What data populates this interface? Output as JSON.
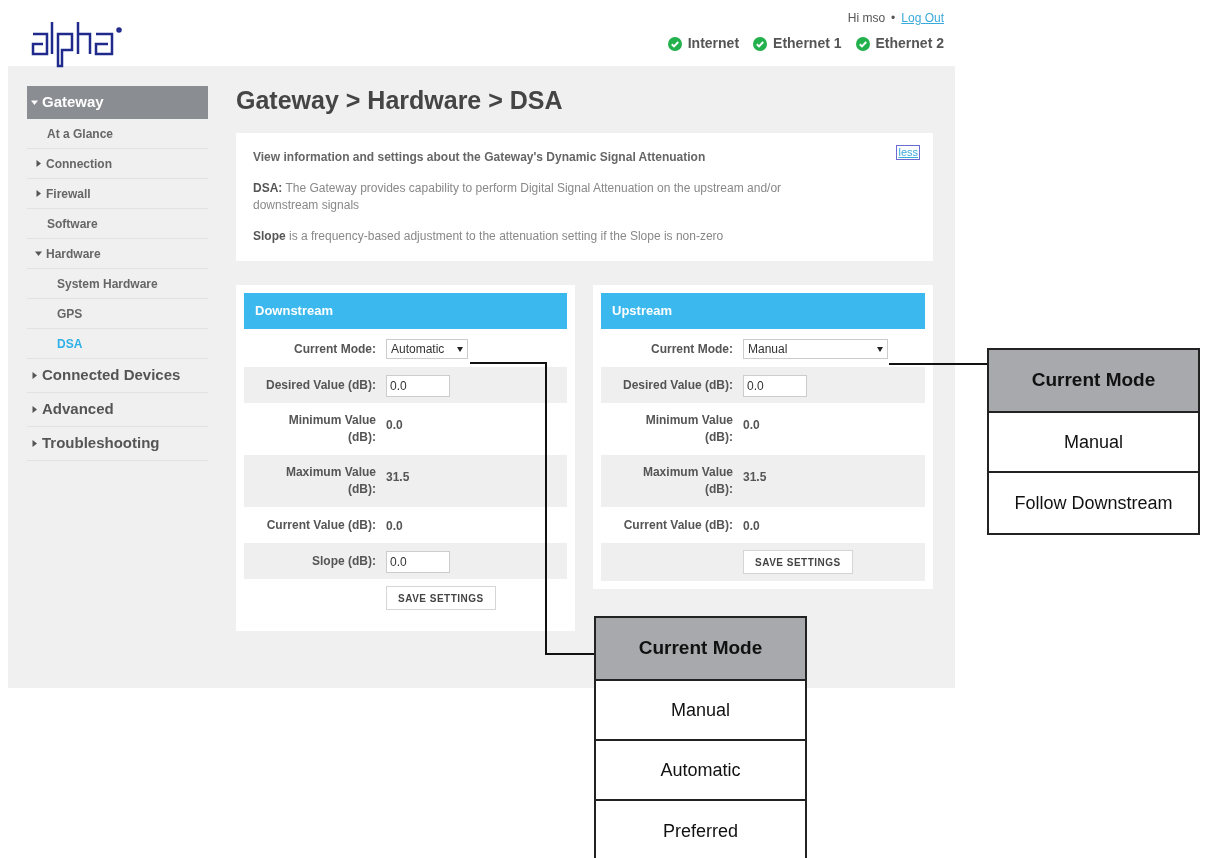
{
  "header": {
    "greeting": "Hi mso",
    "separator": "•",
    "logout": "Log Out",
    "status": [
      {
        "label": "Internet"
      },
      {
        "label": "Ethernet 1"
      },
      {
        "label": "Ethernet 2"
      }
    ]
  },
  "sidebar": {
    "items": [
      {
        "label": "Gateway",
        "expanded": true,
        "children": [
          {
            "label": "At a Glance",
            "selected": false
          },
          {
            "label": "Connection",
            "expanded": false,
            "selected": false
          },
          {
            "label": "Firewall",
            "expanded": false,
            "selected": false
          },
          {
            "label": "Software",
            "selected": false
          },
          {
            "label": "Hardware",
            "expanded": true,
            "selected": false,
            "children": [
              {
                "label": "System Hardware",
                "selected": false
              },
              {
                "label": "GPS",
                "selected": false
              },
              {
                "label": "DSA",
                "selected": true
              }
            ]
          }
        ]
      },
      {
        "label": "Connected Devices",
        "expanded": false
      },
      {
        "label": "Advanced",
        "expanded": false
      },
      {
        "label": "Troubleshooting",
        "expanded": false
      }
    ]
  },
  "title": "Gateway > Hardware > DSA",
  "info": {
    "heading": "View information and settings about the Gateway's Dynamic Signal Attenuation",
    "toggle": "less",
    "paragraphs": [
      "**DSA:** The Gateway provides capability to perform Digital Signal Attenuation on the upstream and/or downstream signals",
      "**Slope** is a frequency-based adjustment to the attenuation setting if the Slope is non-zero"
    ]
  },
  "panels": [
    {
      "title": "Downstream",
      "rows": [
        {
          "kind": "select",
          "label": "Current Mode:",
          "value": "Automatic"
        },
        {
          "kind": "input",
          "label": "Desired Value (dB):",
          "value": "0.0"
        },
        {
          "kind": "value",
          "label": "Minimum Value (dB):",
          "value": "0.0"
        },
        {
          "kind": "value",
          "label": "Maximum Value (dB):",
          "value": "31.5"
        },
        {
          "kind": "value",
          "label": "Current Value (dB):",
          "value": "0.0"
        },
        {
          "kind": "input",
          "label": "Slope (dB):",
          "value": "0.0"
        },
        {
          "kind": "button",
          "label": "SAVE SETTINGS"
        }
      ]
    },
    {
      "title": "Upstream",
      "rows": [
        {
          "kind": "select",
          "label": "Current Mode:",
          "value": "Manual"
        },
        {
          "kind": "input",
          "label": "Desired Value (dB):",
          "value": "0.0"
        },
        {
          "kind": "value",
          "label": "Minimum Value (dB):",
          "value": "0.0"
        },
        {
          "kind": "value",
          "label": "Maximum Value (dB):",
          "value": "31.5"
        },
        {
          "kind": "value",
          "label": "Current Value (dB):",
          "value": "0.0"
        },
        {
          "kind": "button",
          "label": "SAVE SETTINGS"
        }
      ]
    }
  ],
  "callouts": [
    {
      "heading": "Current Mode",
      "options": [
        "Manual",
        "Follow Downstream"
      ]
    },
    {
      "heading": "Current Mode",
      "options": [
        "Manual",
        "Automatic",
        "Preferred"
      ]
    }
  ]
}
